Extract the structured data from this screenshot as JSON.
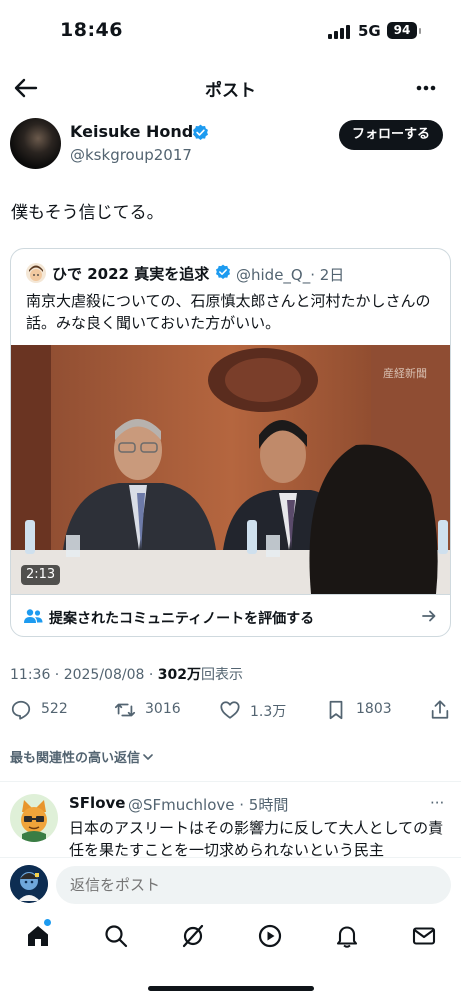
{
  "status": {
    "time": "18:46",
    "network": "5G",
    "battery": "94"
  },
  "header": {
    "title": "ポスト",
    "back_icon": "arrow-left-icon",
    "more_icon": "more-horizontal-icon"
  },
  "author": {
    "name": "Keisuke Honda",
    "handle": "@kskgroup2017",
    "follow_label": "フォローする",
    "verified_color": "#1d9bf0"
  },
  "post": {
    "text": "僕もそう信じてる。",
    "timestamp": "11:36 · 2025/08/08 · ",
    "views_count": "302万",
    "views_label": "回表示"
  },
  "quote": {
    "name": "ひで 2022 真実を追求",
    "meta": "@hide_Q_· 2日",
    "text": "南京大虐殺についての、石原慎太郎さんと河村たかしさんの話。みな良く聞いておいた方がいい。",
    "video_duration": "2:13",
    "watermark": "産経新聞",
    "community_note_label": "提案されたコミュニティノートを評価する"
  },
  "actions": {
    "replies": "522",
    "reposts": "3016",
    "likes": "1.3万",
    "bookmarks": "1803"
  },
  "sort_label": "最も関連性の高い返信",
  "reply": {
    "name": "SFlove",
    "meta": "@SFmuchlove · 5時間",
    "more": "···",
    "text": "日本のアスリートはその影響力に反して大人としての責任を果たすことを一切求められないという民主"
  },
  "reply_bar": {
    "placeholder": "返信をポスト"
  },
  "tabbar": {
    "items": [
      "home-icon",
      "search-icon",
      "grok-icon",
      "video-icon",
      "notifications-icon",
      "messages-icon"
    ]
  },
  "colors": {
    "accent": "#1d9bf0",
    "text": "#0f1419",
    "muted": "#536471"
  }
}
